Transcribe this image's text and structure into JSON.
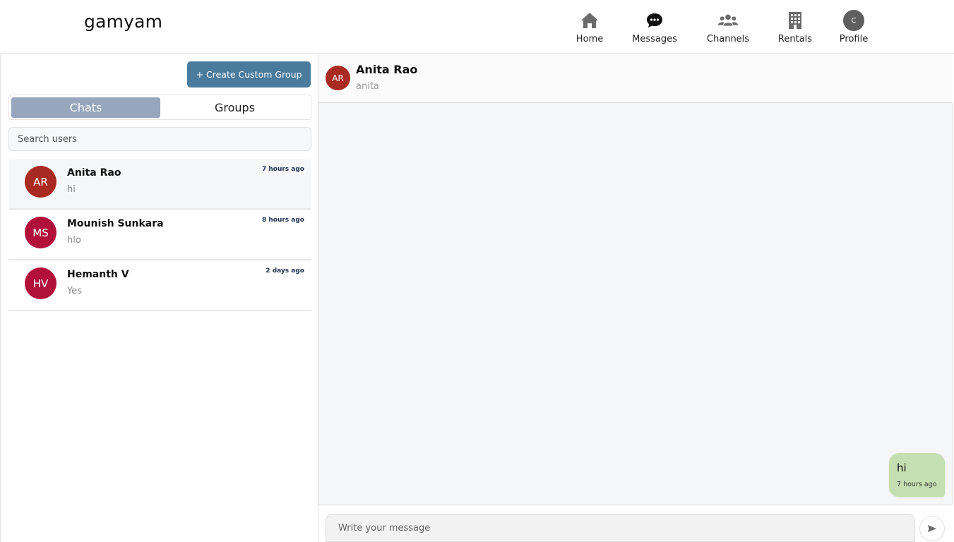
{
  "app": {
    "brand": "gamyam"
  },
  "nav": {
    "home": "Home",
    "messages": "Messages",
    "channels": "Channels",
    "rentals": "Rentals",
    "profile": "Profile",
    "profile_initial": "C"
  },
  "sidebar": {
    "create_group": "+ Create Custom Group",
    "tabs": {
      "chats": "Chats",
      "groups": "Groups"
    },
    "search_placeholder": "Search users",
    "chats": [
      {
        "initials": "AR",
        "name": "Anita Rao",
        "last": "hi",
        "time": "7 hours ago",
        "color": "#a92a22"
      },
      {
        "initials": "MS",
        "name": "Mounish Sunkara",
        "last": "hlo",
        "time": "8 hours ago",
        "color": "#b0103a"
      },
      {
        "initials": "HV",
        "name": "Hemanth V",
        "last": "Yes",
        "time": "2 days ago",
        "color": "#b0103a"
      }
    ]
  },
  "conversation": {
    "initials": "AR",
    "name": "Anita Rao",
    "username": "anita",
    "messages": [
      {
        "text": "hi",
        "time": "7 hours ago"
      }
    ],
    "input_placeholder": "Write your message"
  },
  "colors": {
    "accent": "#4a7b9d",
    "active_tab": "#97a6bd",
    "sent_bubble": "#c5dfb2"
  }
}
